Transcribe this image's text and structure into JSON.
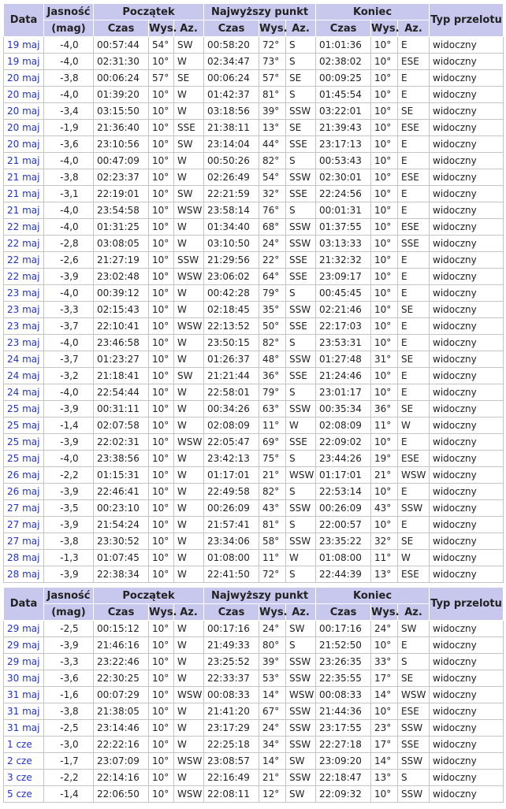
{
  "header": {
    "date": "Data",
    "brightness": "Jasność",
    "brightness_unit": "(mag)",
    "start": "Początek",
    "highest": "Najwyższy punkt",
    "end": "Koniec",
    "type": "Typ przelotu",
    "time": "Czas",
    "alt": "Wys.",
    "az": "Az."
  },
  "table1": [
    [
      "19 maj",
      "-4,0",
      "00:57:44",
      "54°",
      "SW",
      "00:58:20",
      "72°",
      "S",
      "01:01:36",
      "10°",
      "E",
      "widoczny"
    ],
    [
      "19 maj",
      "-4,0",
      "02:31:30",
      "10°",
      "W",
      "02:34:47",
      "73°",
      "S",
      "02:38:02",
      "10°",
      "ESE",
      "widoczny"
    ],
    [
      "20 maj",
      "-3,8",
      "00:06:24",
      "57°",
      "SE",
      "00:06:24",
      "57°",
      "SE",
      "00:09:25",
      "10°",
      "E",
      "widoczny"
    ],
    [
      "20 maj",
      "-4,0",
      "01:39:20",
      "10°",
      "W",
      "01:42:37",
      "81°",
      "S",
      "01:45:54",
      "10°",
      "E",
      "widoczny"
    ],
    [
      "20 maj",
      "-3,4",
      "03:15:50",
      "10°",
      "W",
      "03:18:56",
      "39°",
      "SSW",
      "03:22:01",
      "10°",
      "SE",
      "widoczny"
    ],
    [
      "20 maj",
      "-1,9",
      "21:36:40",
      "10°",
      "SSE",
      "21:38:11",
      "13°",
      "SE",
      "21:39:43",
      "10°",
      "ESE",
      "widoczny"
    ],
    [
      "20 maj",
      "-3,6",
      "23:10:56",
      "10°",
      "SW",
      "23:14:04",
      "44°",
      "SSE",
      "23:17:13",
      "10°",
      "E",
      "widoczny"
    ],
    [
      "21 maj",
      "-4,0",
      "00:47:09",
      "10°",
      "W",
      "00:50:26",
      "82°",
      "S",
      "00:53:43",
      "10°",
      "E",
      "widoczny"
    ],
    [
      "21 maj",
      "-3,8",
      "02:23:37",
      "10°",
      "W",
      "02:26:49",
      "54°",
      "SSW",
      "02:30:01",
      "10°",
      "ESE",
      "widoczny"
    ],
    [
      "21 maj",
      "-3,1",
      "22:19:01",
      "10°",
      "SW",
      "22:21:59",
      "32°",
      "SSE",
      "22:24:56",
      "10°",
      "E",
      "widoczny"
    ],
    [
      "21 maj",
      "-4,0",
      "23:54:58",
      "10°",
      "WSW",
      "23:58:14",
      "76°",
      "S",
      "00:01:31",
      "10°",
      "E",
      "widoczny"
    ],
    [
      "22 maj",
      "-4,0",
      "01:31:25",
      "10°",
      "W",
      "01:34:40",
      "68°",
      "SSW",
      "01:37:55",
      "10°",
      "ESE",
      "widoczny"
    ],
    [
      "22 maj",
      "-2,8",
      "03:08:05",
      "10°",
      "W",
      "03:10:50",
      "24°",
      "SSW",
      "03:13:33",
      "10°",
      "SSE",
      "widoczny"
    ],
    [
      "22 maj",
      "-2,6",
      "21:27:19",
      "10°",
      "SSW",
      "21:29:56",
      "22°",
      "SSE",
      "21:32:32",
      "10°",
      "E",
      "widoczny"
    ],
    [
      "22 maj",
      "-3,9",
      "23:02:48",
      "10°",
      "WSW",
      "23:06:02",
      "64°",
      "SSE",
      "23:09:17",
      "10°",
      "E",
      "widoczny"
    ],
    [
      "23 maj",
      "-4,0",
      "00:39:12",
      "10°",
      "W",
      "00:42:28",
      "79°",
      "S",
      "00:45:45",
      "10°",
      "E",
      "widoczny"
    ],
    [
      "23 maj",
      "-3,3",
      "02:15:43",
      "10°",
      "W",
      "02:18:45",
      "35°",
      "SSW",
      "02:21:46",
      "10°",
      "SE",
      "widoczny"
    ],
    [
      "23 maj",
      "-3,7",
      "22:10:41",
      "10°",
      "WSW",
      "22:13:52",
      "50°",
      "SSE",
      "22:17:03",
      "10°",
      "E",
      "widoczny"
    ],
    [
      "23 maj",
      "-4,0",
      "23:46:58",
      "10°",
      "W",
      "23:50:15",
      "82°",
      "S",
      "23:53:31",
      "10°",
      "E",
      "widoczny"
    ],
    [
      "24 maj",
      "-3,7",
      "01:23:27",
      "10°",
      "W",
      "01:26:37",
      "48°",
      "SSW",
      "01:27:48",
      "31°",
      "SE",
      "widoczny"
    ],
    [
      "24 maj",
      "-3,2",
      "21:18:41",
      "10°",
      "SW",
      "21:21:44",
      "36°",
      "SSE",
      "21:24:46",
      "10°",
      "E",
      "widoczny"
    ],
    [
      "24 maj",
      "-4,0",
      "22:54:44",
      "10°",
      "W",
      "22:58:01",
      "79°",
      "S",
      "23:01:17",
      "10°",
      "E",
      "widoczny"
    ],
    [
      "25 maj",
      "-3,9",
      "00:31:11",
      "10°",
      "W",
      "00:34:26",
      "63°",
      "SSW",
      "00:35:34",
      "36°",
      "SE",
      "widoczny"
    ],
    [
      "25 maj",
      "-1,4",
      "02:07:58",
      "10°",
      "W",
      "02:08:09",
      "11°",
      "W",
      "02:08:09",
      "11°",
      "W",
      "widoczny"
    ],
    [
      "25 maj",
      "-3,9",
      "22:02:31",
      "10°",
      "WSW",
      "22:05:47",
      "69°",
      "SSE",
      "22:09:02",
      "10°",
      "E",
      "widoczny"
    ],
    [
      "25 maj",
      "-4,0",
      "23:38:56",
      "10°",
      "W",
      "23:42:13",
      "75°",
      "S",
      "23:44:26",
      "19°",
      "ESE",
      "widoczny"
    ],
    [
      "26 maj",
      "-2,2",
      "01:15:31",
      "10°",
      "W",
      "01:17:01",
      "21°",
      "WSW",
      "01:17:01",
      "21°",
      "WSW",
      "widoczny"
    ],
    [
      "26 maj",
      "-3,9",
      "22:46:41",
      "10°",
      "W",
      "22:49:58",
      "82°",
      "S",
      "22:53:14",
      "10°",
      "E",
      "widoczny"
    ],
    [
      "27 maj",
      "-3,5",
      "00:23:10",
      "10°",
      "W",
      "00:26:09",
      "43°",
      "SSW",
      "00:26:09",
      "43°",
      "SSW",
      "widoczny"
    ],
    [
      "27 maj",
      "-3,9",
      "21:54:24",
      "10°",
      "W",
      "21:57:41",
      "81°",
      "S",
      "22:00:57",
      "10°",
      "E",
      "widoczny"
    ],
    [
      "27 maj",
      "-3,8",
      "23:30:52",
      "10°",
      "W",
      "23:34:06",
      "58°",
      "SSW",
      "23:35:22",
      "32°",
      "SE",
      "widoczny"
    ],
    [
      "28 maj",
      "-1,3",
      "01:07:45",
      "10°",
      "W",
      "01:08:00",
      "11°",
      "W",
      "01:08:00",
      "11°",
      "W",
      "widoczny"
    ],
    [
      "28 maj",
      "-3,9",
      "22:38:34",
      "10°",
      "W",
      "22:41:50",
      "72°",
      "S",
      "22:44:39",
      "13°",
      "ESE",
      "widoczny"
    ]
  ],
  "table2": [
    [
      "29 maj",
      "-2,5",
      "00:15:12",
      "10°",
      "W",
      "00:17:16",
      "24°",
      "SW",
      "00:17:16",
      "24°",
      "SW",
      "widoczny"
    ],
    [
      "29 maj",
      "-3,9",
      "21:46:16",
      "10°",
      "W",
      "21:49:33",
      "80°",
      "S",
      "21:52:50",
      "10°",
      "E",
      "widoczny"
    ],
    [
      "29 maj",
      "-3,3",
      "23:22:46",
      "10°",
      "W",
      "23:25:52",
      "39°",
      "SSW",
      "23:26:35",
      "33°",
      "S",
      "widoczny"
    ],
    [
      "30 maj",
      "-3,6",
      "22:30:25",
      "10°",
      "W",
      "22:33:37",
      "53°",
      "SSW",
      "22:35:55",
      "17°",
      "SE",
      "widoczny"
    ],
    [
      "31 maj",
      "-1,6",
      "00:07:29",
      "10°",
      "WSW",
      "00:08:33",
      "14°",
      "WSW",
      "00:08:33",
      "14°",
      "WSW",
      "widoczny"
    ],
    [
      "31 maj",
      "-3,8",
      "21:38:05",
      "10°",
      "W",
      "21:41:20",
      "67°",
      "SSW",
      "21:44:36",
      "10°",
      "ESE",
      "widoczny"
    ],
    [
      "31 maj",
      "-2,5",
      "23:14:46",
      "10°",
      "W",
      "23:17:29",
      "24°",
      "SSW",
      "23:17:55",
      "23°",
      "SSW",
      "widoczny"
    ],
    [
      "1 cze",
      "-3,0",
      "22:22:16",
      "10°",
      "W",
      "22:25:18",
      "34°",
      "SSW",
      "22:27:18",
      "17°",
      "SSE",
      "widoczny"
    ],
    [
      "2 cze",
      "-1,7",
      "23:07:09",
      "10°",
      "WSW",
      "23:08:57",
      "14°",
      "SW",
      "23:09:20",
      "14°",
      "SSW",
      "widoczny"
    ],
    [
      "3 cze",
      "-2,2",
      "22:14:16",
      "10°",
      "W",
      "22:16:49",
      "21°",
      "SSW",
      "22:18:47",
      "13°",
      "S",
      "widoczny"
    ],
    [
      "5 cze",
      "-1,4",
      "22:06:50",
      "10°",
      "WSW",
      "22:08:11",
      "12°",
      "SW",
      "22:09:32",
      "10°",
      "SSW",
      "widoczny"
    ]
  ]
}
